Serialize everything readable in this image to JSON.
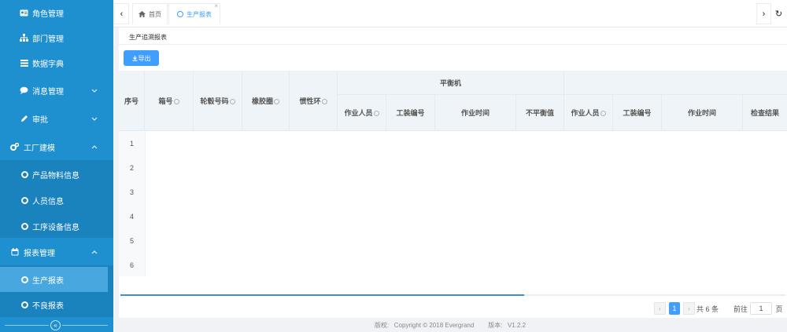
{
  "sidebar": {
    "items": [
      {
        "label": "角色管理",
        "icon": "id-card-icon"
      },
      {
        "label": "部门管理",
        "icon": "sitemap-icon"
      },
      {
        "label": "数据字典",
        "icon": "list-icon"
      },
      {
        "label": "消息管理",
        "icon": "chat-icon",
        "arrow": "chevron-down-icon"
      },
      {
        "label": "审批",
        "icon": "pencil-icon",
        "arrow": "chevron-down-icon"
      },
      {
        "label": "工厂建模",
        "icon": "cogs-icon",
        "arrow": "chevron-up-icon"
      },
      {
        "label": "产品物料信息",
        "icon": "circle-icon"
      },
      {
        "label": "人员信息",
        "icon": "circle-icon"
      },
      {
        "label": "工序设备信息",
        "icon": "circle-icon"
      },
      {
        "label": "报表管理",
        "icon": "calendar-icon",
        "arrow": "chevron-up-icon"
      },
      {
        "label": "生产报表",
        "icon": "circle-icon"
      },
      {
        "label": "不良报表",
        "icon": "circle-icon"
      }
    ],
    "collapse_glyph": "«"
  },
  "topbar": {
    "tabs": [
      {
        "label": "首页",
        "icon": "home-icon"
      },
      {
        "label": "生产报表",
        "icon": "circle-icon"
      }
    ],
    "prev_glyph": "‹",
    "next_glyph": "›",
    "refresh_glyph": "↻",
    "close_glyph": "×"
  },
  "content": {
    "heading": "生产追溯报表",
    "export_label": "导出"
  },
  "table": {
    "group_header": "平衡机",
    "headers": {
      "seq": "序号",
      "box": "箱号",
      "hub": "轮毂号码",
      "rubber": "橡胶圈",
      "inertia": "惯性环",
      "operator1": "作业人员",
      "fixture1": "工装编号",
      "time1": "作业时间",
      "imbalance": "不平衡值",
      "operator2": "作业人员",
      "fixture2": "工装编号",
      "time2": "作业时间",
      "result": "检查结果"
    },
    "rows": [
      "1",
      "2",
      "3",
      "4",
      "5",
      "6"
    ]
  },
  "pagination": {
    "prev_glyph": "‹",
    "current_page": "1",
    "next_glyph": "›",
    "total": "共 6 条",
    "goto_label": "前往",
    "goto_value": "1",
    "page_unit": "页"
  },
  "footer": {
    "text": "版权:   Copyright © 2018 Evergrand        版本:   V1.2.2"
  },
  "colors": {
    "sidebar": "#1e8fcf",
    "sidebar_active": "#48a7de",
    "primary": "#409eff",
    "header_bg": "#eef4f8"
  }
}
